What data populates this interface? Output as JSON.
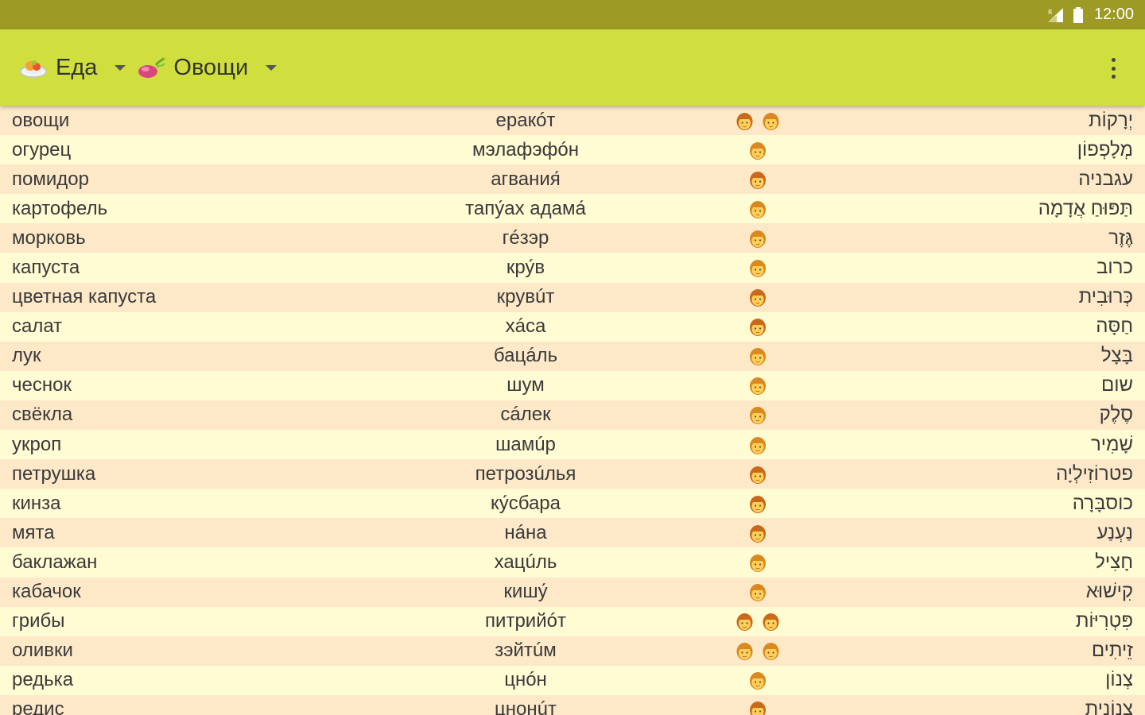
{
  "status_bar": {
    "time": "12:00",
    "icons": [
      "signal-icon",
      "battery-icon"
    ]
  },
  "app_bar": {
    "category": {
      "label": "Еда",
      "icon": "food-plate-icon"
    },
    "subcategory": {
      "label": "Овощи",
      "icon": "vegetable-icon"
    },
    "menu_icon": "overflow-menu-icon"
  },
  "colors": {
    "status_bar": "#9d9a25",
    "app_bar": "#d0df3e",
    "row_odd": "#fde9c8",
    "row_even": "#fffbd2"
  },
  "words": [
    {
      "ru": "овощи",
      "tr": "еракóт",
      "he": "יְרָקוֹת",
      "speakers": [
        "female",
        "male"
      ]
    },
    {
      "ru": "огурец",
      "tr": "мэлафэфóн",
      "he": "מְלָפְפוֹן",
      "speakers": [
        "male"
      ]
    },
    {
      "ru": "помидор",
      "tr": "агвания́",
      "he": "עגבניה",
      "speakers": [
        "female"
      ]
    },
    {
      "ru": "картофель",
      "tr": "тапу́ах адама́",
      "he": "תַּפּוּחַ אֲדָמָה",
      "speakers": [
        "male"
      ]
    },
    {
      "ru": "морковь",
      "tr": "гéзэр",
      "he": "גֶּזֶר",
      "speakers": [
        "male"
      ]
    },
    {
      "ru": "капуста",
      "tr": "кру́в",
      "he": "כרוב",
      "speakers": [
        "male"
      ]
    },
    {
      "ru": "цветная капуста",
      "tr": "крувúт",
      "he": "כְּרוּבִית",
      "speakers": [
        "female"
      ]
    },
    {
      "ru": "салат",
      "tr": "хáса",
      "he": "חַסָּה",
      "speakers": [
        "female"
      ]
    },
    {
      "ru": "лук",
      "tr": "бацáль",
      "he": "בָּצָל",
      "speakers": [
        "male"
      ]
    },
    {
      "ru": "чеснок",
      "tr": "шум",
      "he": "שום",
      "speakers": [
        "male"
      ]
    },
    {
      "ru": "свёкла",
      "tr": "сáлек",
      "he": "סֶלֶק",
      "speakers": [
        "male"
      ]
    },
    {
      "ru": "укроп",
      "tr": "шамúр",
      "he": "שָׁמִיר",
      "speakers": [
        "male"
      ]
    },
    {
      "ru": "петрушка",
      "tr": "петрозúлья",
      "he": "פטרוֹזִילְיָה",
      "speakers": [
        "female"
      ]
    },
    {
      "ru": "кинза",
      "tr": "ку́сбара",
      "he": "כוסבָּרָה",
      "speakers": [
        "female"
      ]
    },
    {
      "ru": "мята",
      "tr": "нáна",
      "he": "נַעְנַע",
      "speakers": [
        "female"
      ]
    },
    {
      "ru": "баклажан",
      "tr": "хацúль",
      "he": "חָצִיל",
      "speakers": [
        "male"
      ]
    },
    {
      "ru": "кабачок",
      "tr": "кишу́",
      "he": "קִישׁוּא",
      "speakers": [
        "male"
      ]
    },
    {
      "ru": "грибы",
      "tr": "питрийóт",
      "he": "פִּטְרִיּוֹת",
      "speakers": [
        "female",
        "female"
      ]
    },
    {
      "ru": "оливки",
      "tr": "зэйтúм",
      "he": "זֵיתִים",
      "speakers": [
        "male",
        "male"
      ]
    },
    {
      "ru": "редька",
      "tr": "цнóн",
      "he": "צְנוֹן",
      "speakers": [
        "male"
      ]
    },
    {
      "ru": "редис",
      "tr": "цнонúт",
      "he": "צְנוֹנִית",
      "speakers": [
        "female"
      ]
    }
  ]
}
